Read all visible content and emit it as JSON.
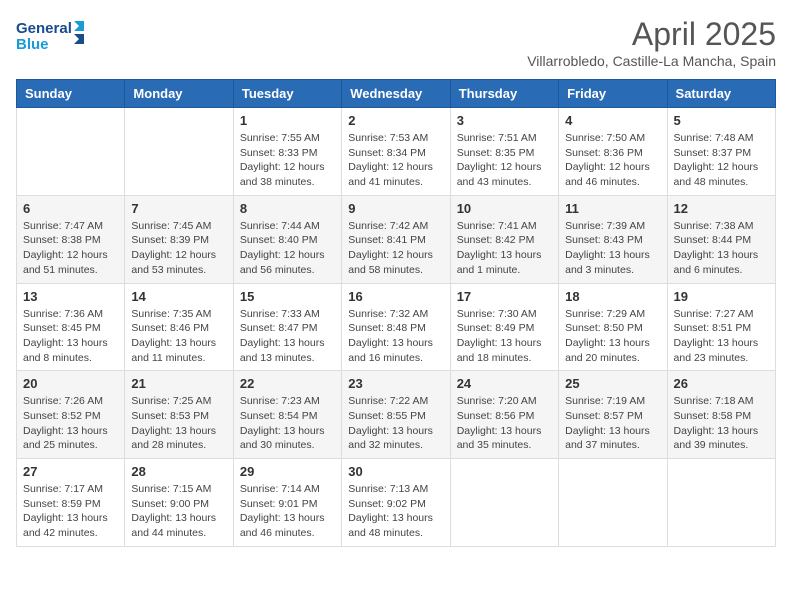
{
  "header": {
    "logo_general": "General",
    "logo_blue": "Blue",
    "title": "April 2025",
    "subtitle": "Villarrobledo, Castille-La Mancha, Spain"
  },
  "weekdays": [
    "Sunday",
    "Monday",
    "Tuesday",
    "Wednesday",
    "Thursday",
    "Friday",
    "Saturday"
  ],
  "weeks": [
    [
      {
        "day": "",
        "info": ""
      },
      {
        "day": "",
        "info": ""
      },
      {
        "day": "1",
        "info": "Sunrise: 7:55 AM\nSunset: 8:33 PM\nDaylight: 12 hours and 38 minutes."
      },
      {
        "day": "2",
        "info": "Sunrise: 7:53 AM\nSunset: 8:34 PM\nDaylight: 12 hours and 41 minutes."
      },
      {
        "day": "3",
        "info": "Sunrise: 7:51 AM\nSunset: 8:35 PM\nDaylight: 12 hours and 43 minutes."
      },
      {
        "day": "4",
        "info": "Sunrise: 7:50 AM\nSunset: 8:36 PM\nDaylight: 12 hours and 46 minutes."
      },
      {
        "day": "5",
        "info": "Sunrise: 7:48 AM\nSunset: 8:37 PM\nDaylight: 12 hours and 48 minutes."
      }
    ],
    [
      {
        "day": "6",
        "info": "Sunrise: 7:47 AM\nSunset: 8:38 PM\nDaylight: 12 hours and 51 minutes."
      },
      {
        "day": "7",
        "info": "Sunrise: 7:45 AM\nSunset: 8:39 PM\nDaylight: 12 hours and 53 minutes."
      },
      {
        "day": "8",
        "info": "Sunrise: 7:44 AM\nSunset: 8:40 PM\nDaylight: 12 hours and 56 minutes."
      },
      {
        "day": "9",
        "info": "Sunrise: 7:42 AM\nSunset: 8:41 PM\nDaylight: 12 hours and 58 minutes."
      },
      {
        "day": "10",
        "info": "Sunrise: 7:41 AM\nSunset: 8:42 PM\nDaylight: 13 hours and 1 minute."
      },
      {
        "day": "11",
        "info": "Sunrise: 7:39 AM\nSunset: 8:43 PM\nDaylight: 13 hours and 3 minutes."
      },
      {
        "day": "12",
        "info": "Sunrise: 7:38 AM\nSunset: 8:44 PM\nDaylight: 13 hours and 6 minutes."
      }
    ],
    [
      {
        "day": "13",
        "info": "Sunrise: 7:36 AM\nSunset: 8:45 PM\nDaylight: 13 hours and 8 minutes."
      },
      {
        "day": "14",
        "info": "Sunrise: 7:35 AM\nSunset: 8:46 PM\nDaylight: 13 hours and 11 minutes."
      },
      {
        "day": "15",
        "info": "Sunrise: 7:33 AM\nSunset: 8:47 PM\nDaylight: 13 hours and 13 minutes."
      },
      {
        "day": "16",
        "info": "Sunrise: 7:32 AM\nSunset: 8:48 PM\nDaylight: 13 hours and 16 minutes."
      },
      {
        "day": "17",
        "info": "Sunrise: 7:30 AM\nSunset: 8:49 PM\nDaylight: 13 hours and 18 minutes."
      },
      {
        "day": "18",
        "info": "Sunrise: 7:29 AM\nSunset: 8:50 PM\nDaylight: 13 hours and 20 minutes."
      },
      {
        "day": "19",
        "info": "Sunrise: 7:27 AM\nSunset: 8:51 PM\nDaylight: 13 hours and 23 minutes."
      }
    ],
    [
      {
        "day": "20",
        "info": "Sunrise: 7:26 AM\nSunset: 8:52 PM\nDaylight: 13 hours and 25 minutes."
      },
      {
        "day": "21",
        "info": "Sunrise: 7:25 AM\nSunset: 8:53 PM\nDaylight: 13 hours and 28 minutes."
      },
      {
        "day": "22",
        "info": "Sunrise: 7:23 AM\nSunset: 8:54 PM\nDaylight: 13 hours and 30 minutes."
      },
      {
        "day": "23",
        "info": "Sunrise: 7:22 AM\nSunset: 8:55 PM\nDaylight: 13 hours and 32 minutes."
      },
      {
        "day": "24",
        "info": "Sunrise: 7:20 AM\nSunset: 8:56 PM\nDaylight: 13 hours and 35 minutes."
      },
      {
        "day": "25",
        "info": "Sunrise: 7:19 AM\nSunset: 8:57 PM\nDaylight: 13 hours and 37 minutes."
      },
      {
        "day": "26",
        "info": "Sunrise: 7:18 AM\nSunset: 8:58 PM\nDaylight: 13 hours and 39 minutes."
      }
    ],
    [
      {
        "day": "27",
        "info": "Sunrise: 7:17 AM\nSunset: 8:59 PM\nDaylight: 13 hours and 42 minutes."
      },
      {
        "day": "28",
        "info": "Sunrise: 7:15 AM\nSunset: 9:00 PM\nDaylight: 13 hours and 44 minutes."
      },
      {
        "day": "29",
        "info": "Sunrise: 7:14 AM\nSunset: 9:01 PM\nDaylight: 13 hours and 46 minutes."
      },
      {
        "day": "30",
        "info": "Sunrise: 7:13 AM\nSunset: 9:02 PM\nDaylight: 13 hours and 48 minutes."
      },
      {
        "day": "",
        "info": ""
      },
      {
        "day": "",
        "info": ""
      },
      {
        "day": "",
        "info": ""
      }
    ]
  ]
}
